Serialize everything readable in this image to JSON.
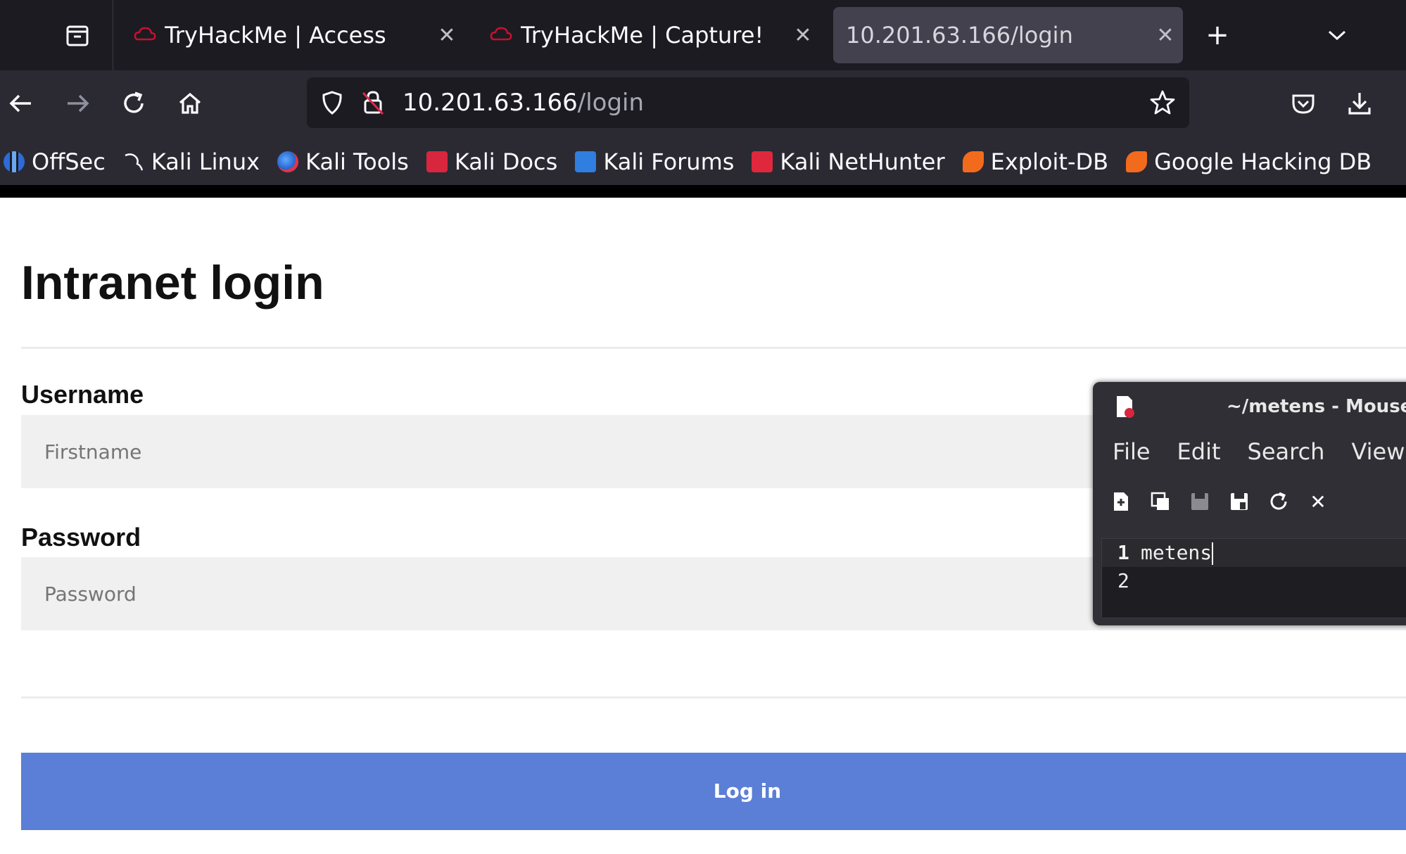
{
  "browser": {
    "tabs": [
      {
        "title": "TryHackMe | Access",
        "active": false
      },
      {
        "title": "TryHackMe | Capture!",
        "active": false
      },
      {
        "title": "10.201.63.166/login",
        "active": true
      }
    ],
    "url": {
      "host": "10.201.63.166",
      "path": "/login"
    },
    "bookmarks": [
      {
        "label": "OffSec",
        "icon": "offsec-icon"
      },
      {
        "label": "Kali Linux",
        "icon": "kali-dragon-icon"
      },
      {
        "label": "Kali Tools",
        "icon": "kali-tools-icon"
      },
      {
        "label": "Kali Docs",
        "icon": "kali-docs-icon"
      },
      {
        "label": "Kali Forums",
        "icon": "kali-forums-icon"
      },
      {
        "label": "Kali NetHunter",
        "icon": "kali-nethunter-icon"
      },
      {
        "label": "Exploit-DB",
        "icon": "exploit-db-icon"
      },
      {
        "label": "Google Hacking DB",
        "icon": "ghdb-icon"
      }
    ]
  },
  "page": {
    "title": "Intranet login",
    "username_label": "Username",
    "username_placeholder": "Firstname",
    "password_label": "Password",
    "password_placeholder": "Password",
    "login_label": "Log in"
  },
  "mousepad": {
    "title": "~/metens - Mousepad",
    "menu": [
      "File",
      "Edit",
      "Search",
      "View"
    ],
    "lines": [
      {
        "number": "1",
        "text": "metens"
      },
      {
        "number": "2",
        "text": ""
      }
    ]
  },
  "colors": {
    "login_button": "#5b7fd6",
    "tab_bar": "#1c1b22",
    "nav_bar": "#2b2a33"
  }
}
